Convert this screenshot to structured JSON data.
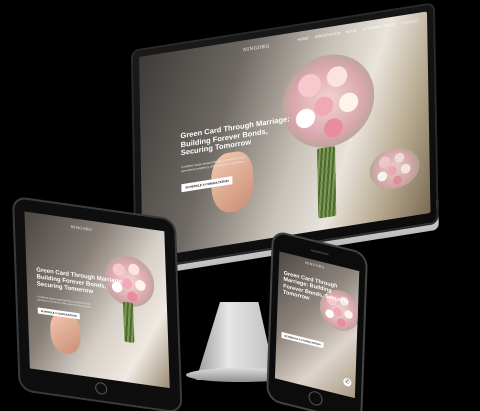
{
  "site": {
    "logo": "NINGORG",
    "nav": [
      "HOME",
      "IMMIGRATION",
      "BLOG",
      "ATTORNEY BLOG",
      "CONTACT"
    ],
    "hero_title": "Green Card Through Marriage: Building Forever Bonds, Securing Tomorrow",
    "hero_subtitle": "Confident steps toward lifelong commitment and permanent residency with experienced guidance.",
    "cta_label": "SCHEDULE A CONSULTATION"
  },
  "colors": {
    "background": "#000000",
    "text": "#ffffff",
    "cta_bg": "#ffffff",
    "bouquet_pink": "#f2a9b6"
  },
  "icons": {
    "chat": "chat-bubble-icon",
    "home": "home-button-icon"
  }
}
